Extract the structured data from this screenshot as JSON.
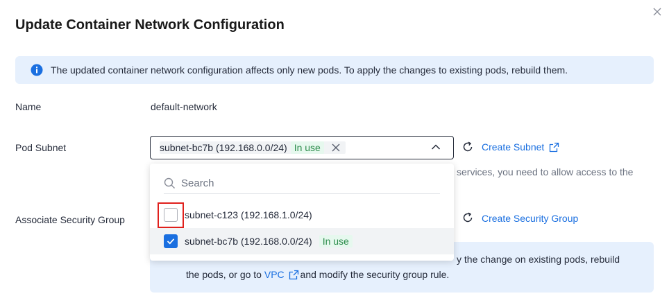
{
  "dialog": {
    "title": "Update Container Network Configuration"
  },
  "banner": {
    "text": "The updated container network configuration affects only new pods. To apply the changes to existing pods, rebuild them."
  },
  "form": {
    "name_label": "Name",
    "name_value": "default-network",
    "pod_subnet_label": "Pod Subnet",
    "security_group_label": "Associate Security Group"
  },
  "pod_subnet": {
    "selected_text": "subnet-bc7b (192.168.0.0/24)",
    "selected_tag": "In use",
    "create_link": "Create Subnet",
    "help_text_partial": "services, you need to allow access to the"
  },
  "security_group": {
    "create_link": "Create Security Group",
    "note_line1_partial": "y the change on existing pods, rebuild",
    "note_line2_prefix": "the pods, or go to ",
    "note_line2_link": "VPC",
    "note_line2_suffix": " and modify the security group rule."
  },
  "dropdown": {
    "search_placeholder": "Search",
    "options": [
      {
        "label": "subnet-c123 (192.168.1.0/24)",
        "checked": false,
        "tag": ""
      },
      {
        "label": "subnet-bc7b (192.168.0.0/24)",
        "checked": true,
        "tag": "In use"
      }
    ]
  },
  "colors": {
    "accent": "#1a6fe0",
    "banner_bg": "#e6f0fd",
    "tag_bg": "#e6f8ee",
    "tag_fg": "#2c8c4b",
    "highlight": "#e0201c"
  }
}
